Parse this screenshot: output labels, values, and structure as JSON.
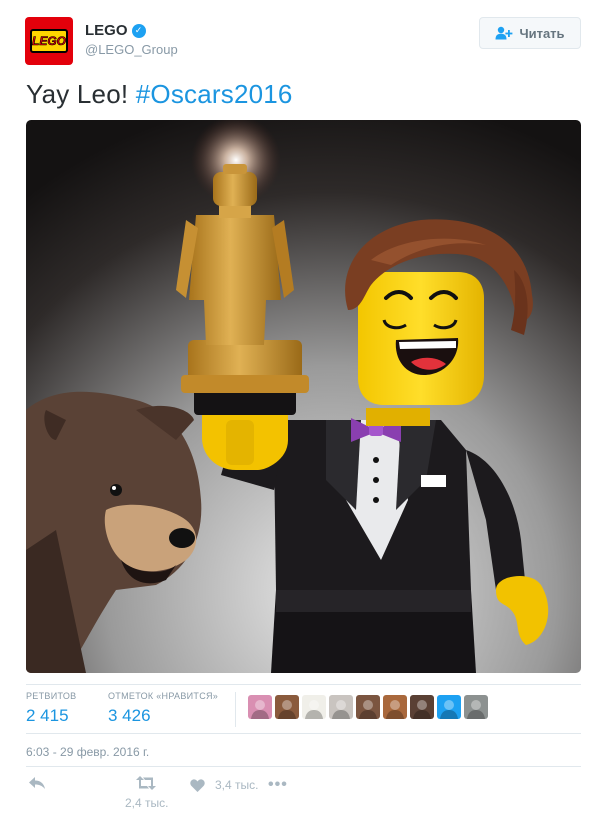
{
  "account": {
    "logo_text": "LEGO",
    "name": "LEGO",
    "handle": "@LEGO_Group"
  },
  "follow_button": {
    "label": "Читать",
    "icon": "add-user-icon"
  },
  "tweet": {
    "text": "Yay Leo!",
    "hashtag": "#Oscars2016"
  },
  "stats": {
    "retweets_label": "РЕТВИТОВ",
    "retweets_value": "2 415",
    "likes_label": "ОТМЕТОК «НРАВИТСЯ»",
    "likes_value": "3 426"
  },
  "likers": [
    {
      "icon": "liker-avatar",
      "color": "#d98fb2"
    },
    {
      "icon": "liker-avatar",
      "color": "#8a5a3c"
    },
    {
      "icon": "liker-avatar",
      "color": "#f0efe9"
    },
    {
      "icon": "liker-avatar",
      "color": "#c9c4c0"
    },
    {
      "icon": "liker-avatar",
      "color": "#7b5540"
    },
    {
      "icon": "liker-avatar",
      "color": "#a9683c"
    },
    {
      "icon": "liker-avatar",
      "color": "#5a4034"
    },
    {
      "icon": "liker-avatar",
      "color": "#1da1f2"
    },
    {
      "icon": "liker-avatar",
      "color": "#8c9190"
    }
  ],
  "timestamp": "6:03 - 29 февр. 2016 г.",
  "actions": {
    "reply_icon": "reply-icon",
    "retweet_icon": "retweet-icon",
    "retweet_count": "2,4 тыс.",
    "like_icon": "heart-icon",
    "like_count": "3,4 тыс.",
    "more_icon": "more-icon"
  },
  "colors": {
    "link": "#1b95e0",
    "muted": "#8899a6",
    "lego_red": "#e3000b",
    "lego_yellow": "#ffd500"
  }
}
